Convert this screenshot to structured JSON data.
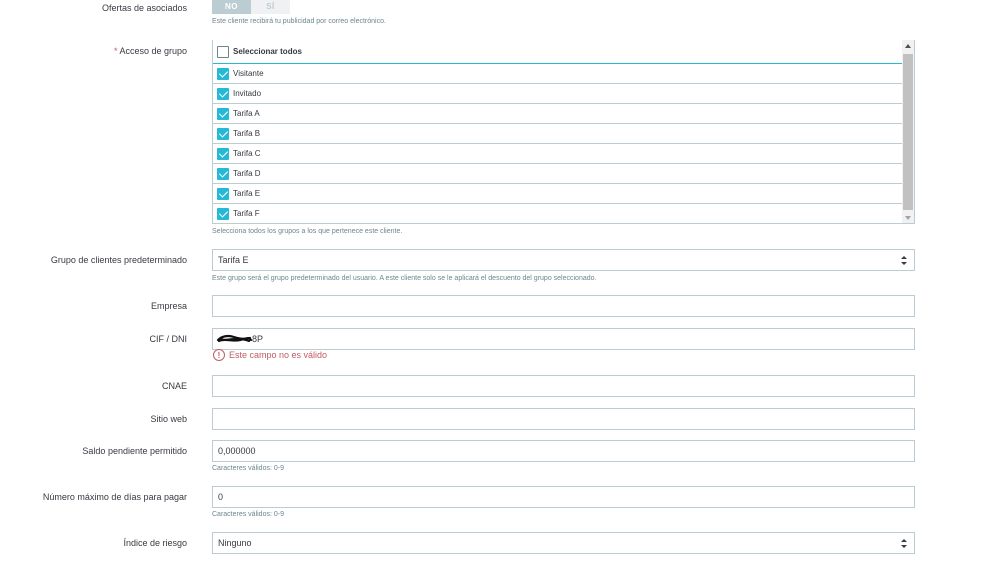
{
  "partner_offers": {
    "label": "Ofertas de asociados",
    "no_label": "NO",
    "yes_label": "SÍ",
    "selected": "NO",
    "help": "Este cliente recibirá tu publicidad por correo electrónico."
  },
  "group_access": {
    "label": "Acceso de grupo",
    "required_marker": "*",
    "select_all_label": "Seleccionar todos",
    "select_all_checked": false,
    "groups": [
      {
        "label": "Visitante",
        "checked": true
      },
      {
        "label": "Invitado",
        "checked": true
      },
      {
        "label": "Tarifa A",
        "checked": true
      },
      {
        "label": "Tarifa B",
        "checked": true
      },
      {
        "label": "Tarifa C",
        "checked": true
      },
      {
        "label": "Tarifa D",
        "checked": true
      },
      {
        "label": "Tarifa E",
        "checked": true
      },
      {
        "label": "Tarifa F",
        "checked": true
      }
    ],
    "help": "Selecciona todos los grupos a los que pertenece este cliente."
  },
  "default_group": {
    "label": "Grupo de clientes predeterminado",
    "value": "Tarifa E",
    "help": "Este grupo será el grupo predeterminado del usuario. A este cliente solo se le aplicará el descuento del grupo seleccionado."
  },
  "company": {
    "label": "Empresa",
    "value": ""
  },
  "cif": {
    "label": "CIF / DNI",
    "value_visible": "8P",
    "error_icon": "!",
    "error": "Este campo no es válido"
  },
  "cnae": {
    "label": "CNAE",
    "value": ""
  },
  "website": {
    "label": "Sitio web",
    "value": ""
  },
  "outstanding": {
    "label": "Saldo pendiente permitido",
    "value": "0,000000",
    "help": "Caracteres válidos: 0-9"
  },
  "max_days": {
    "label": "Número máximo de días para pagar",
    "value": "0",
    "help": "Caracteres válidos: 0-9"
  },
  "risk": {
    "label": "Índice de riesgo",
    "value": "Ninguno"
  },
  "colors": {
    "accent": "#25b9d7",
    "error": "#c05c67",
    "border": "#bbcdd2",
    "help_text": "#6c868e"
  }
}
